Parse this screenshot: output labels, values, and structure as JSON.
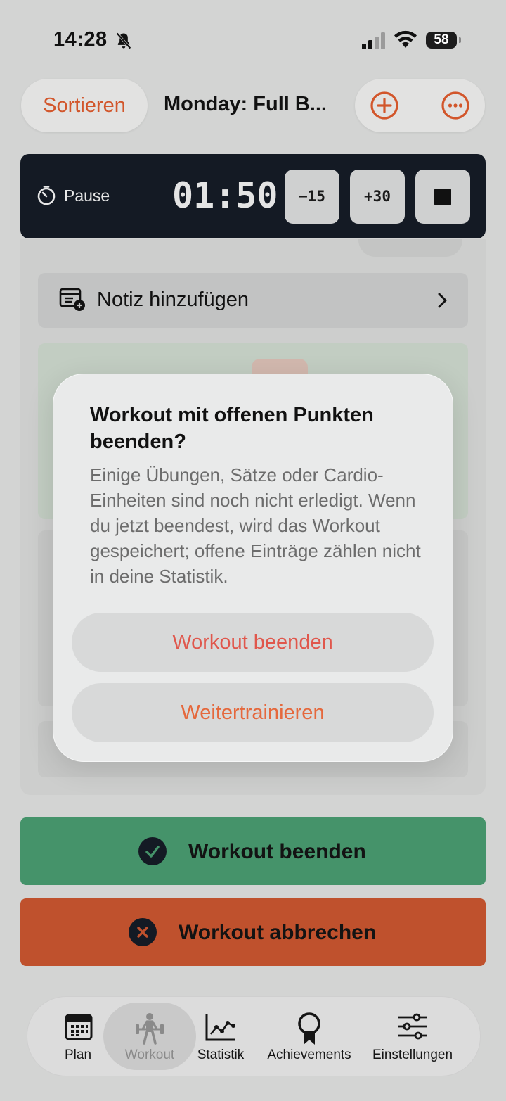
{
  "status_bar": {
    "time": "14:28",
    "battery": "58"
  },
  "header": {
    "sort_label": "Sortieren",
    "title": "Monday: Full B..."
  },
  "timer": {
    "label": "Pause",
    "value": "01:50",
    "minus_label": "−15",
    "plus_label": "+30"
  },
  "content": {
    "note_label": "Notiz hinzufügen"
  },
  "actions": {
    "finish_label": "Workout beenden",
    "abort_label": "Workout abbrechen"
  },
  "tabs": [
    {
      "label": "Plan",
      "icon": "calendar-icon"
    },
    {
      "label": "Workout",
      "icon": "weightlifter-icon",
      "active": true
    },
    {
      "label": "Statistik",
      "icon": "chart-icon"
    },
    {
      "label": "Achievements",
      "icon": "ribbon-icon"
    },
    {
      "label": "Einstellungen",
      "icon": "sliders-icon"
    }
  ],
  "dialog": {
    "title": "Workout mit offenen Punkten beenden?",
    "message": "Einige Übungen, Sätze oder Cardio-Einheiten sind noch nicht erledigt. Wenn du jetzt beendest, wird das Workout gespeichert; offene Einträge zählen nicht in deine Statistik.",
    "confirm_label": "Workout beenden",
    "cancel_label": "Weitertrainieren"
  },
  "colors": {
    "accent": "#d2562b",
    "destructive": "#e0574c",
    "success": "#45936a",
    "danger": "#bf512d",
    "timer_bg": "#141a24"
  }
}
